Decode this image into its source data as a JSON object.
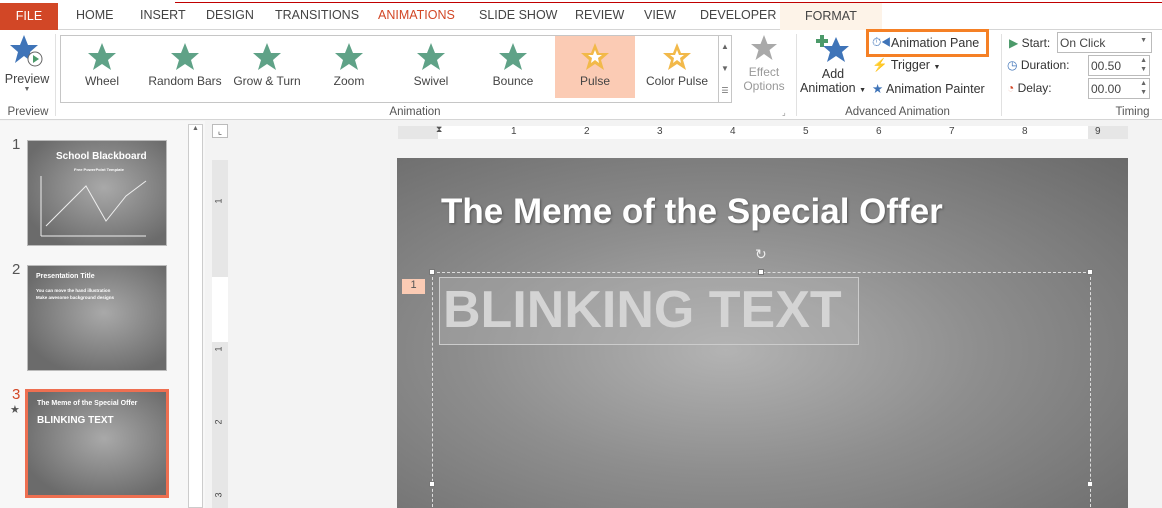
{
  "tabs": [
    "FILE",
    "HOME",
    "INSERT",
    "DESIGN",
    "TRANSITIONS",
    "ANIMATIONS",
    "SLIDE SHOW",
    "REVIEW",
    "VIEW",
    "DEVELOPER",
    "FORMAT"
  ],
  "ribbon": {
    "preview": {
      "label": "Preview",
      "group": "Preview"
    },
    "animations": [
      "Wheel",
      "Random Bars",
      "Grow & Turn",
      "Zoom",
      "Swivel",
      "Bounce",
      "Pulse",
      "Color Pulse"
    ],
    "selected_animation": "Pulse",
    "animation_group": "Animation",
    "effect_options": [
      "Effect",
      "Options"
    ],
    "add_animation": [
      "Add",
      "Animation"
    ],
    "animation_pane": "Animation Pane",
    "trigger": "Trigger",
    "animation_painter": "Animation Painter",
    "advanced_group": "Advanced Animation",
    "timing": {
      "start_label": "Start:",
      "start_value": "On Click",
      "duration_label": "Duration:",
      "duration_value": "00.50",
      "delay_label": "Delay:",
      "delay_value": "00.00",
      "group": "Timing"
    }
  },
  "slides": [
    {
      "num": "1",
      "title": "School Blackboard",
      "subtitle": "Free PowerPoint Template"
    },
    {
      "num": "2",
      "title": "Presentation Title",
      "bullets": [
        "You can move the hand illustration",
        "Make awesome background designs"
      ]
    },
    {
      "num": "3",
      "title": "The Meme of the Special Offer",
      "body": "BLINKING TEXT"
    }
  ],
  "ruler": {
    "h": [
      "1",
      "2",
      "3",
      "4",
      "5",
      "6",
      "7",
      "8",
      "9"
    ],
    "v": [
      "1",
      "1",
      "2",
      "3"
    ]
  },
  "slide": {
    "title": "The Meme of the Special Offer",
    "body": "BLINKING TEXT",
    "anim_tag": "1"
  },
  "colors": {
    "accent": "#d24726",
    "highlight": "#fbcbb4",
    "pane_box": "#f58025"
  }
}
